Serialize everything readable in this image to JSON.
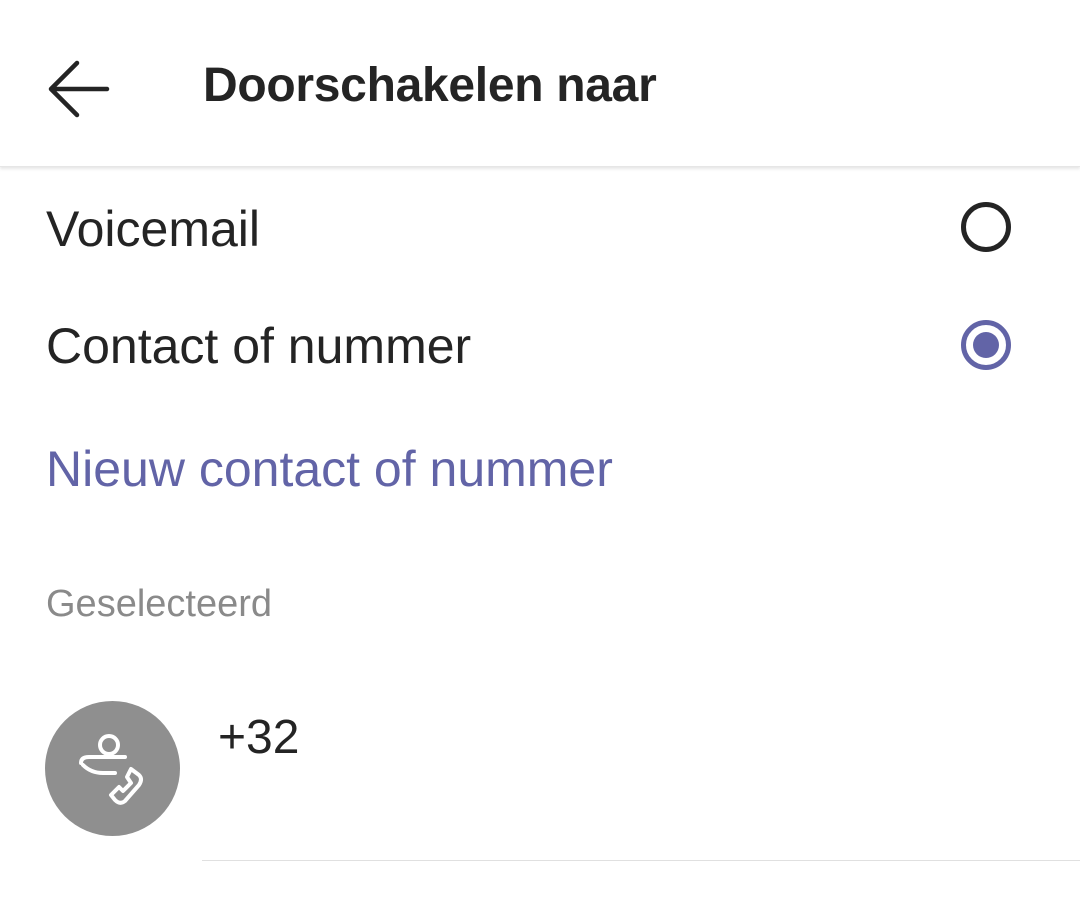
{
  "header": {
    "title": "Doorschakelen naar",
    "back_icon": "arrow-left-icon"
  },
  "options": [
    {
      "label": "Voicemail",
      "selected": false
    },
    {
      "label": "Contact of nummer",
      "selected": true
    }
  ],
  "new_contact_link": "Nieuw contact of nummer",
  "selected_section": {
    "header": "Geselecteerd",
    "item": {
      "number": "+32",
      "avatar_icon": "person-phone-icon"
    }
  },
  "colors": {
    "accent": "#6264a7",
    "text": "#242424",
    "muted": "#8a8a8a",
    "avatar_bg": "#8f8f8f"
  }
}
